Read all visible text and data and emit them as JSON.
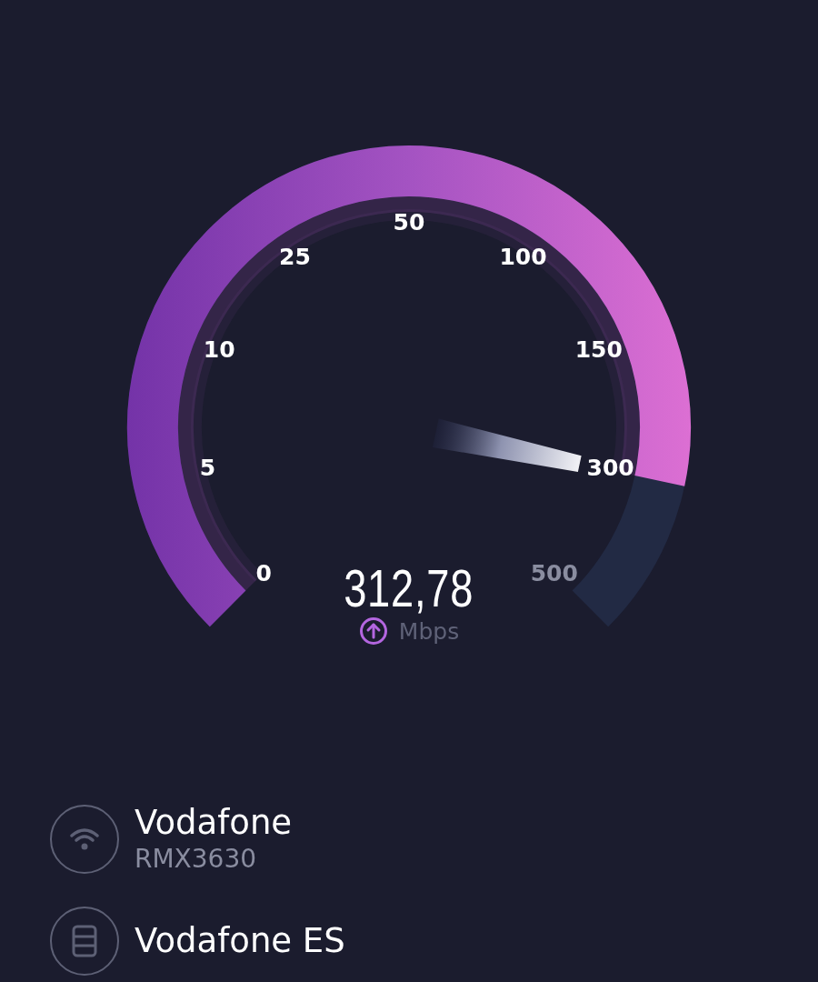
{
  "gauge": {
    "scale": [
      "0",
      "5",
      "10",
      "25",
      "50",
      "100",
      "150",
      "300",
      "500"
    ],
    "reading": "312,78",
    "unit": "Mbps"
  },
  "connections": [
    {
      "kind": "wifi",
      "name": "Vodafone",
      "detail": "RMX3630"
    },
    {
      "kind": "server",
      "name": "Vodafone ES"
    }
  ]
}
